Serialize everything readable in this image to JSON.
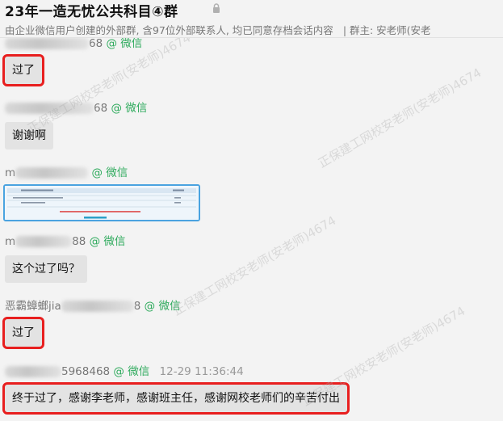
{
  "header": {
    "title": "23年一造无忧公共科目④群",
    "subtitle": "由企业微信用户创建的外部群, 含97位外部联系人, 均已同意存档会话内容",
    "owner": "| 群主: 安老师(安老"
  },
  "watermark": "正保建工网校安老师(安老师)4674",
  "wechat_tag": "@ 微信",
  "messages": [
    {
      "sender_suffix": "68",
      "text": "过了"
    },
    {
      "sender_suffix": "68",
      "text": "谢谢啊"
    },
    {
      "sender_prefix": "m",
      "sender_suffix": "",
      "image": true
    },
    {
      "sender_prefix": "m",
      "sender_suffix": "88",
      "text": "这个过了吗？"
    },
    {
      "sender_prefix": "恶霸蟑螂jia",
      "sender_suffix": "8",
      "text": "过了"
    },
    {
      "sender_suffix": "5968468",
      "time": "12-29 11:36:44",
      "text": "终于过了，感谢李老师，感谢班主任，感谢网校老师们的辛苦付出"
    }
  ],
  "colors": {
    "highlight": "#e81f1f",
    "wechat": "#2eaa5c",
    "bubble": "#e3e3e3"
  }
}
